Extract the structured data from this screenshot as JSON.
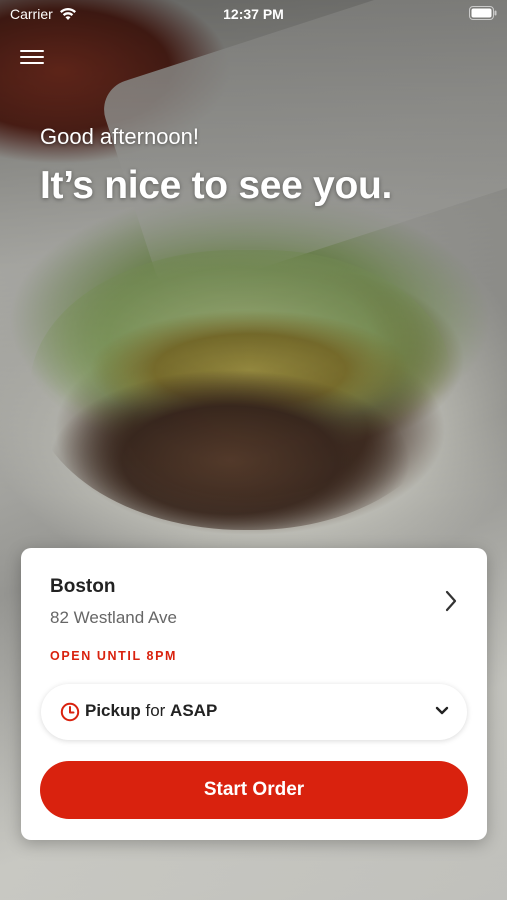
{
  "status_bar": {
    "carrier": "Carrier",
    "time": "12:37 PM",
    "wifi_icon": "wifi-icon",
    "battery_icon": "battery-icon"
  },
  "header": {
    "menu_icon": "hamburger-menu-icon"
  },
  "greeting": {
    "subtitle": "Good afternoon!",
    "title": "It’s nice to see you."
  },
  "location": {
    "name": "Boston",
    "address": "82 Westland Ave",
    "status": "OPEN UNTIL 8PM",
    "chevron_icon": "chevron-right-icon"
  },
  "pickup": {
    "icon": "clock-icon",
    "mode": "Pickup",
    "connector": " for ",
    "time": "ASAP",
    "dropdown_icon": "chevron-down-icon"
  },
  "actions": {
    "start_order_label": "Start Order"
  },
  "colors": {
    "accent": "#d9220e",
    "card": "#ffffff",
    "text_primary": "#222222",
    "text_secondary": "#666666"
  }
}
